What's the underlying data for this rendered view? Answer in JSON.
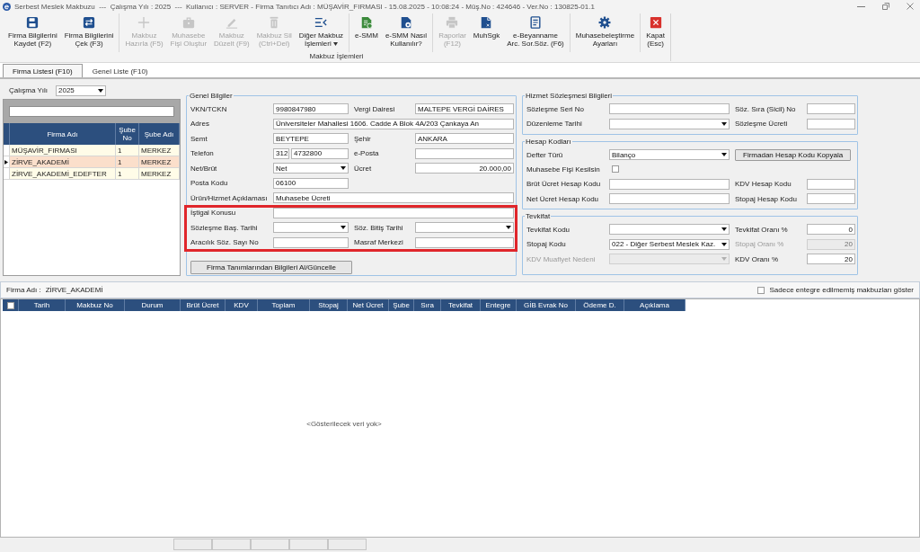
{
  "window": {
    "title": "Serbest Meslek Makbuzu  ---  Çalışma Yılı : 2025  ---  Kullanıcı : SERVER - Firma Tanıtıcı Adı : MÜŞAVİR_FIRMASI - 15.08.2025 - 10:08:24 - Müş.No : 424646 - Ver.No : 130825-01.1"
  },
  "ribbon": {
    "group_label": "Makbuz İşlemleri",
    "sections": [
      {
        "buttons": [
          {
            "label": "Firma Bilgilerini\nKaydet (F2)",
            "disabled": false,
            "has_menu": false
          },
          {
            "label": "Firma Bilgilerini\nÇek (F3)",
            "disabled": false,
            "has_menu": false
          }
        ]
      },
      {
        "buttons": [
          {
            "label": "Makbuz\nHazırla (F5)",
            "disabled": true,
            "has_menu": false
          },
          {
            "label": "Muhasebe\nFişi Oluştur",
            "disabled": true,
            "has_menu": false
          },
          {
            "label": "Makbuz\nDüzelt (F9)",
            "disabled": true,
            "has_menu": false
          },
          {
            "label": "Makbuz Sil\n(Ctrl+Del)",
            "disabled": true,
            "has_menu": false
          },
          {
            "label": "Diğer Makbuz\nİşlemleri",
            "disabled": false,
            "has_menu": true
          }
        ]
      },
      {
        "buttons": [
          {
            "label": "e-SMM",
            "disabled": false,
            "has_menu": false
          },
          {
            "label": "e-SMM Nasıl\nKullanılır?",
            "disabled": false,
            "has_menu": false
          }
        ]
      },
      {
        "buttons": [
          {
            "label": "Raporlar\n(F12)",
            "disabled": true,
            "has_menu": false
          },
          {
            "label": "MuhSgk",
            "disabled": false,
            "has_menu": false
          },
          {
            "label": "e-Beyanname\nArc. Sor.Söz. (F6)",
            "disabled": false,
            "has_menu": false
          }
        ]
      },
      {
        "buttons": [
          {
            "label": "Muhasebeleştirme\nAyarları",
            "disabled": false,
            "has_menu": false
          }
        ]
      },
      {
        "buttons": [
          {
            "label": "Kapat\n(Esc)",
            "disabled": false,
            "has_menu": false
          }
        ]
      }
    ]
  },
  "tabs": [
    {
      "label": "Firma Listesi (F10)",
      "selected": true
    },
    {
      "label": "Genel Liste (F10)",
      "selected": false
    }
  ],
  "year": {
    "label": "Çalışma Yılı",
    "value": "2025"
  },
  "firm_list": {
    "columns": [
      "Firma Adı",
      "Şube No",
      "Şube Adı"
    ],
    "rows": [
      {
        "cells": [
          "MÜŞAVİR_FIRMASI",
          "1",
          "MERKEZ"
        ],
        "selected": false
      },
      {
        "cells": [
          "ZİRVE_AKADEMİ",
          "1",
          "MERKEZ"
        ],
        "selected": true
      },
      {
        "cells": [
          "ZİRVE_AKADEMİ_EDEFTER",
          "1",
          "MERKEZ"
        ],
        "selected": false
      }
    ]
  },
  "general_info": {
    "title": "Genel Bilgiler",
    "rows": [
      {
        "highlighted": false,
        "fields": [
          {
            "kind": "text",
            "label": "VKN/TCKN",
            "value": "9980847980"
          },
          {
            "kind": "text",
            "label": "Vergi Dairesi",
            "value": "MALTEPE VERGİ DAİRES"
          }
        ]
      },
      {
        "highlighted": false,
        "fields": [
          {
            "kind": "wide",
            "label": "Adres",
            "value": "Üniversiteler Mahallesi 1606. Cadde A Blok 4A/203 Çankaya An"
          }
        ]
      },
      {
        "highlighted": false,
        "fields": [
          {
            "kind": "text",
            "label": "Semt",
            "value": "BEYTEPE"
          },
          {
            "kind": "text",
            "label": "Şehir",
            "value": "ANKARA"
          }
        ]
      },
      {
        "highlighted": false,
        "fields": [
          {
            "kind": "phone",
            "label": "Telefon",
            "area_code": "312",
            "value": "4732800"
          },
          {
            "kind": "text",
            "label": "e-Posta"
          }
        ]
      },
      {
        "highlighted": false,
        "fields": [
          {
            "kind": "dropdown",
            "label": "Net/Brüt",
            "value": "Net"
          },
          {
            "kind": "number",
            "label": "Ücret",
            "value": "20.000,00"
          }
        ]
      },
      {
        "highlighted": false,
        "fields": [
          {
            "kind": "text",
            "label": "Posta Kodu",
            "value": "06100"
          }
        ]
      },
      {
        "highlighted": false,
        "fields": [
          {
            "kind": "wide",
            "label": "Ürün/Hizmet Açıklaması",
            "value": "Muhasebe Ücreti"
          }
        ]
      },
      {
        "highlighted": true,
        "fields": [
          {
            "kind": "wide",
            "label": "İştigal Konusu"
          }
        ]
      },
      {
        "highlighted": true,
        "fields": [
          {
            "kind": "dropdown",
            "label": "Sözleşme Baş. Tarihi"
          },
          {
            "kind": "dropdown",
            "label": "Söz. Bitiş Tarihi"
          }
        ]
      },
      {
        "highlighted": true,
        "fields": [
          {
            "kind": "text",
            "label": "Aracılık Söz. Sayı No"
          },
          {
            "kind": "text",
            "label": "Masraf Merkezi"
          }
        ]
      }
    ],
    "button": "Firma Tanımlarından Bilgileri Al/Güncelle"
  },
  "service_contract": {
    "title": "Hizmet Sözleşmesi Bilgileri",
    "rows": [
      {
        "fields": [
          {
            "kind": "text",
            "label": "Sözleşme Seri No"
          },
          {
            "kind": "text",
            "label": "Söz. Sıra (Sicil) No"
          }
        ]
      },
      {
        "fields": [
          {
            "kind": "dropdown",
            "label": "Düzenleme Tarihi"
          },
          {
            "kind": "text",
            "label": "Sözleşme Ücreti"
          }
        ]
      }
    ]
  },
  "account_codes": {
    "title": "Hesap Kodları",
    "rows": [
      {
        "fields": [
          {
            "kind": "dropdown",
            "label": "Defter Türü",
            "value": "Bilanço"
          },
          {
            "kind": "button",
            "label": "Firmadan Hesap Kodu Kopyala"
          }
        ]
      },
      {
        "fields": [
          {
            "kind": "checkbox",
            "label": "Muhasebe Fişi Kesilsin",
            "checked": false
          }
        ]
      },
      {
        "fields": [
          {
            "kind": "text",
            "label": "Brüt Ücret Hesap Kodu"
          },
          {
            "kind": "text",
            "label": "KDV Hesap Kodu"
          }
        ]
      },
      {
        "fields": [
          {
            "kind": "text",
            "label": "Net Ücret Hesap Kodu"
          },
          {
            "kind": "text",
            "label": "Stopaj Hesap Kodu"
          }
        ]
      }
    ]
  },
  "withholding": {
    "title": "Tevkifat",
    "rows": [
      {
        "fields": [
          {
            "kind": "dropdown",
            "label": "Tevkifat Kodu",
            "disabled": false
          },
          {
            "kind": "number",
            "label": "Tevkifat Oranı %",
            "value": "0",
            "disabled": false
          }
        ]
      },
      {
        "fields": [
          {
            "kind": "dropdown",
            "label": "Stopaj Kodu",
            "value": "022 - Diğer Serbest Meslek Kaz.",
            "disabled": false
          },
          {
            "kind": "number",
            "label": "Stopaj Oranı %",
            "value": "20",
            "disabled": true
          }
        ]
      },
      {
        "fields": [
          {
            "kind": "dropdown",
            "label": "KDV Muafiyet Nedeni",
            "disabled": true
          },
          {
            "kind": "number",
            "label": "KDV Oranı %",
            "value": "20",
            "disabled": false
          }
        ]
      }
    ]
  },
  "receipts": {
    "firm_label": "Firma Adı :",
    "firm_name": "ZİRVE_AKADEMİ",
    "filter": {
      "label": "Sadece entegre edilmemiş makbuzları göster",
      "checked": false
    },
    "select_all": {
      "checked": false
    },
    "columns": [
      "Tarih",
      "Makbuz No",
      "Durum",
      "Brüt Ücret",
      "KDV",
      "Toplam",
      "Stopaj",
      "Net Ücret",
      "Şube",
      "Sıra",
      "Tevkifat",
      "Entegre",
      "GİB Evrak No",
      "Ödeme D.",
      "Açıklama"
    ],
    "empty_text": "<Gösterilecek veri yok>"
  }
}
